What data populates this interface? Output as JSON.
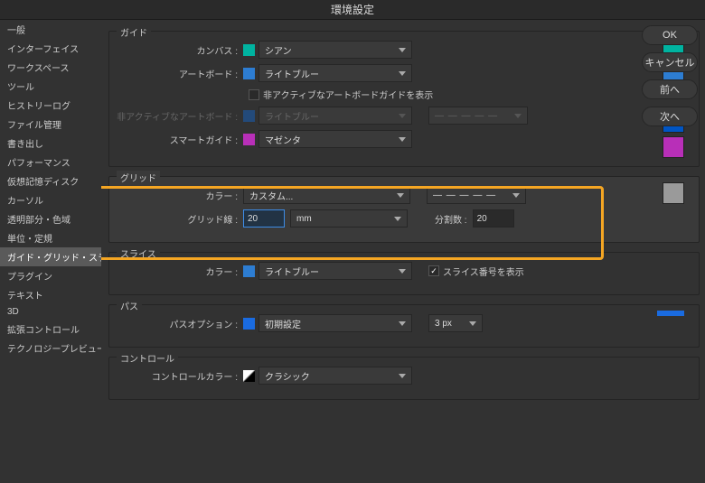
{
  "title": "環境設定",
  "sidebar": {
    "items": [
      "一般",
      "インターフェイス",
      "ワークスペース",
      "ツール",
      "ヒストリーログ",
      "ファイル管理",
      "書き出し",
      "パフォーマンス",
      "仮想記憶ディスク",
      "カーソル",
      "透明部分・色域",
      "単位・定規",
      "ガイド・グリッド・スライス",
      "プラグイン",
      "テキスト",
      "3D",
      "拡張コントロール",
      "テクノロジープレビュー"
    ],
    "selectedIndex": 12
  },
  "sections": {
    "guide": {
      "title": "ガイド",
      "canvas_label": "カンバス :",
      "canvas_value": "シアン",
      "canvas_color": "#00b3a0",
      "artboard_label": "アートボード :",
      "artboard_value": "ライトブルー",
      "artboard_color": "#2d7dd2",
      "inactive_check_label": "非アクティブなアートボードガイドを表示",
      "inactive_label": "非アクティブなアートボード :",
      "inactive_value": "ライトブルー",
      "inactive_dash": "— — — — —",
      "inactive_color": "#0055c4",
      "smart_label": "スマートガイド :",
      "smart_value": "マゼンタ",
      "smart_color": "#b82fb8"
    },
    "grid": {
      "title": "グリッド",
      "color_label": "カラー :",
      "color_value": "カスタム...",
      "dash": "— — — — —",
      "grid_color": "#9a9a9a",
      "gridline_label": "グリッド線 :",
      "gridline_value": "20",
      "gridline_unit": "mm",
      "division_label": "分割数 :",
      "division_value": "20"
    },
    "slice": {
      "title": "スライス",
      "color_label": "カラー :",
      "color_value": "ライトブルー",
      "color_hex": "#2d7dd2",
      "numbers_label": "スライス番号を表示"
    },
    "path": {
      "title": "パス",
      "option_label": "パスオプション :",
      "option_value": "初期設定",
      "px_value": "3 px",
      "path_color": "#1a6be0"
    },
    "control": {
      "title": "コントロール",
      "label": "コントロールカラー :",
      "value": "クラシック"
    }
  },
  "buttons": {
    "ok": "OK",
    "cancel": "キャンセル",
    "prev": "前へ",
    "next": "次へ"
  }
}
